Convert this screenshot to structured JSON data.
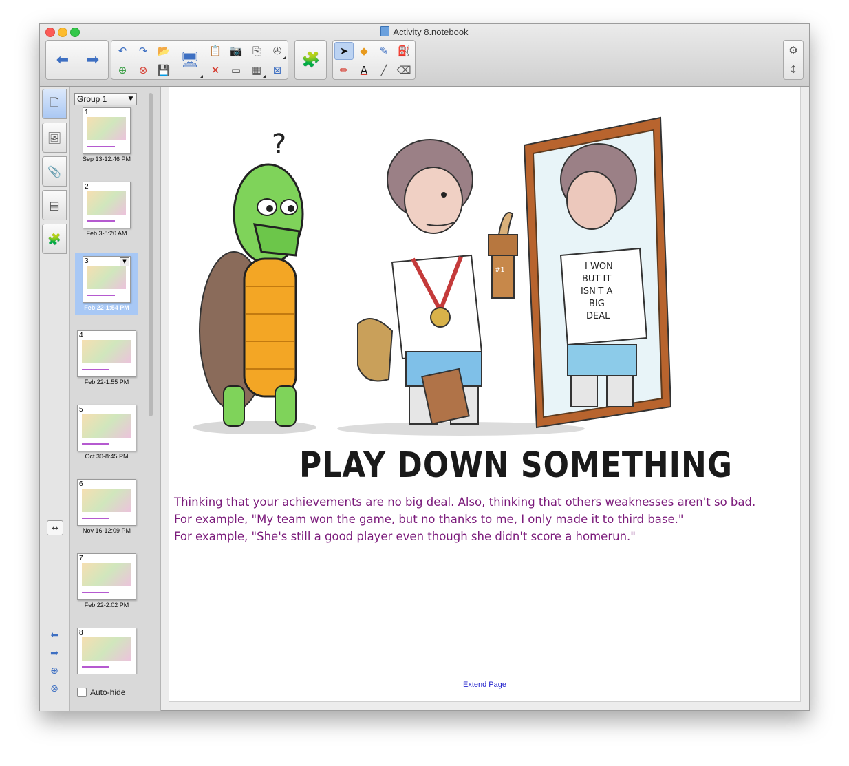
{
  "window": {
    "title": "Activity 8.notebook"
  },
  "toolbar": {
    "back_icon": "arrow-left",
    "forward_icon": "arrow-right",
    "gear_icon": "gear",
    "expand_icon": "vertical-resize"
  },
  "sorter": {
    "group_label": "Group 1",
    "auto_hide_label": "Auto-hide",
    "pages": [
      {
        "num": "1",
        "date": "Sep 13-12:46 PM"
      },
      {
        "num": "2",
        "date": "Feb 3-8:20 AM"
      },
      {
        "num": "3",
        "date": "Feb 22-1:54 PM"
      },
      {
        "num": "4",
        "date": "Feb 22-1:55 PM"
      },
      {
        "num": "5",
        "date": "Oct 30-8:45 PM"
      },
      {
        "num": "6",
        "date": "Nov 16-12:09 PM"
      },
      {
        "num": "7",
        "date": "Feb 22-2:02 PM"
      },
      {
        "num": "8",
        "date": ""
      }
    ]
  },
  "canvas": {
    "cartoon_title": "PLAY DOWN SOMETHING",
    "shirt_text": [
      "I WON",
      "BUT IT",
      "ISN'T A",
      "BIG",
      "DEAL"
    ],
    "trophy_label": "#1",
    "question_mark": "?",
    "line1": "Thinking that your achievements are no big deal.  Also, thinking that others weaknesses aren't so bad.",
    "line2": "For example, \"My team won the game, but no thanks to me, I only made it to third base.\"",
    "line3": "For example, \"She's still a good player even though she didn't score a homerun.\"",
    "extend_label": "Extend Page"
  },
  "colors": {
    "text_purple": "#7b1b7b",
    "selection_blue": "#a8c8f5",
    "link_blue": "#1e1ecc"
  }
}
